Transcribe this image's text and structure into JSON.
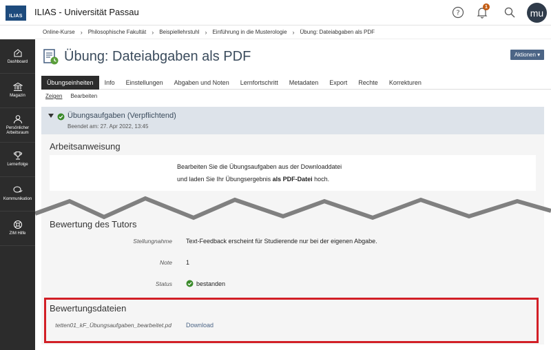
{
  "header": {
    "logo_text": "ILIAS",
    "installation_title": "ILIAS - Universität Passau",
    "notification_count": "1",
    "avatar_initials": "mu"
  },
  "breadcrumb": [
    "Online-Kurse",
    "Philosophische Fakultät",
    "Beispiellehrstuhl",
    "Einführung in die Musterologie",
    "Übung: Dateiabgaben als PDF"
  ],
  "sidebar": {
    "items": [
      {
        "label": "Dashboard",
        "icon": "dashboard-icon"
      },
      {
        "label": "Magazin",
        "icon": "bank-icon"
      },
      {
        "label": "Persönlicher Arbeitsraum",
        "icon": "person-icon"
      },
      {
        "label": "Lernerfolge",
        "icon": "trophy-icon"
      },
      {
        "label": "Kommunikation",
        "icon": "chat-icon"
      },
      {
        "label": "ZIM Hilfe",
        "icon": "lifebuoy-icon"
      }
    ]
  },
  "page": {
    "title": "Übung: Dateiabgaben als PDF",
    "actions_label": "Aktionen ▾"
  },
  "tabs": [
    "Übungseinheiten",
    "Info",
    "Einstellungen",
    "Abgaben und Noten",
    "Lernfortschritt",
    "Metadaten",
    "Export",
    "Rechte",
    "Korrekturen"
  ],
  "subtabs": [
    "Zeigen",
    "Bearbeiten"
  ],
  "assignment": {
    "title": "Übungsaufgaben (Verpflichtend)",
    "status": "Beendet am: 27. Apr 2022, 13:45"
  },
  "instructions": {
    "heading": "Arbeitsanweisung",
    "line1": "Bearbeiten Sie die Übungsaufgaben aus der Downloaddatei",
    "line2_pre": "und laden Sie Ihr Übungsergebnis ",
    "line2_bold": "als PDF-Datei",
    "line2_post": " hoch."
  },
  "tutor": {
    "heading": "Bewertung des Tutors",
    "comment_label": "Stellungnahme",
    "comment_value": "Text-Feedback erscheint für Studierende nur bei der eigenen Abgabe.",
    "grade_label": "Note",
    "grade_value": "1",
    "status_label": "Status",
    "status_value": "bestanden"
  },
  "files": {
    "heading": "Bewertungsdateien",
    "filename": "tetten01_kF_Übungsaufgaben_bearbeitet.pd",
    "download_label": "Download"
  },
  "colors": {
    "sidebar_bg": "#2c2c2c",
    "accent": "#4c6586",
    "highlight_frame": "#d21f26",
    "success": "#3a8a2a"
  }
}
